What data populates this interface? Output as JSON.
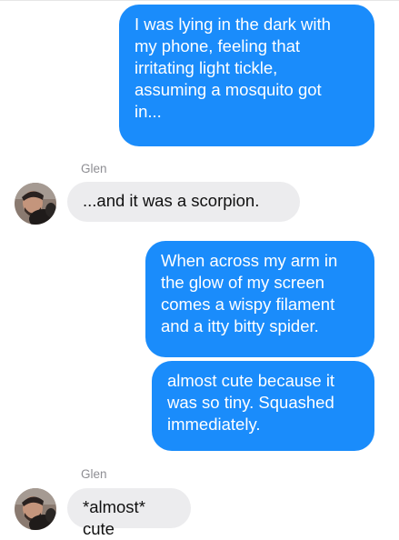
{
  "colors": {
    "sent_bubble": "#1a8cfb",
    "received_bubble": "#ececee",
    "sender_name": "#8e8e93"
  },
  "messages": [
    {
      "direction": "sent",
      "text": "I was lying in the dark with\nmy phone, feeling that\nirritating light tickle,\nassuming a mosquito got\nin..."
    },
    {
      "direction": "received",
      "sender": "Glen",
      "text": "...and it was a scorpion."
    },
    {
      "direction": "sent",
      "text": "When across my arm in\nthe glow of my screen\ncomes a wispy filament\nand a itty bitty spider."
    },
    {
      "direction": "sent",
      "text": "almost cute because it\nwas so tiny.  Squashed\nimmediately."
    },
    {
      "direction": "received",
      "sender": "Glen",
      "text": "*almost* cute"
    }
  ],
  "avatar_icon": "contact-photo"
}
